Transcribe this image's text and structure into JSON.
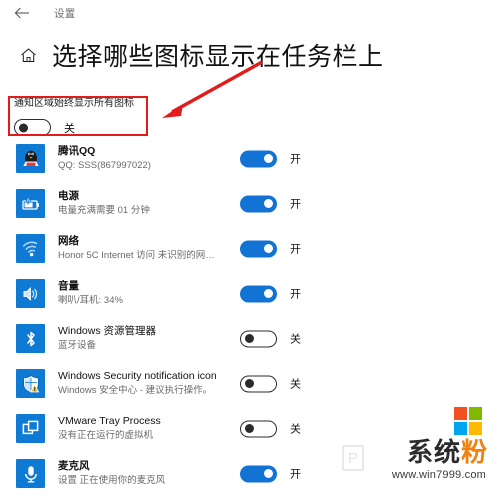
{
  "window": {
    "back_icon": "back-arrow-icon",
    "app_name": "设置"
  },
  "header": {
    "home_icon": "home-icon",
    "title": "选择哪些图标显示在任务栏上"
  },
  "global_setting": {
    "label": "通知区域始终显示所有图标",
    "state": "关",
    "on": false
  },
  "labels": {
    "on": "开",
    "off": "关"
  },
  "items": [
    {
      "icon": "qq-penguin-icon",
      "title": "腾讯QQ",
      "subtitle": "QQ: SSS(867997022)",
      "state": "开",
      "on": true,
      "latin": false
    },
    {
      "icon": "battery-power-icon",
      "title": "电源",
      "subtitle": "电量充满需要 01 分钟",
      "state": "开",
      "on": true,
      "latin": false
    },
    {
      "icon": "wifi-network-icon",
      "title": "网络",
      "subtitle": "Honor 5C Internet 访问  未识别的网…",
      "state": "开",
      "on": true,
      "latin": false
    },
    {
      "icon": "speaker-volume-icon",
      "title": "音量",
      "subtitle": "喇叭/耳机: 34%",
      "state": "开",
      "on": true,
      "latin": false
    },
    {
      "icon": "bluetooth-icon",
      "title": "Windows 资源管理器",
      "subtitle": "蓝牙设备",
      "state": "关",
      "on": false,
      "latin": true
    },
    {
      "icon": "security-shield-icon",
      "title": "Windows Security notification icon",
      "subtitle": "Windows 安全中心 - 建议执行操作。",
      "state": "关",
      "on": false,
      "latin": true
    },
    {
      "icon": "vmware-squares-icon",
      "title": "VMware Tray Process",
      "subtitle": "没有正在运行的虚拟机",
      "state": "关",
      "on": false,
      "latin": true
    },
    {
      "icon": "microphone-icon",
      "title": "麦克风",
      "subtitle": "设置 正在使用你的麦克风",
      "state": "开",
      "on": true,
      "latin": false
    }
  ],
  "annotation": {
    "box_color": "#e21b1b",
    "arrow_color": "#e21b1b"
  },
  "watermark": {
    "brand_part1": "系统",
    "brand_part2": "粉",
    "url": "www.win7999.com",
    "logo_colors": [
      "#f25022",
      "#7fba00",
      "#00a4ef",
      "#ffb900"
    ]
  }
}
